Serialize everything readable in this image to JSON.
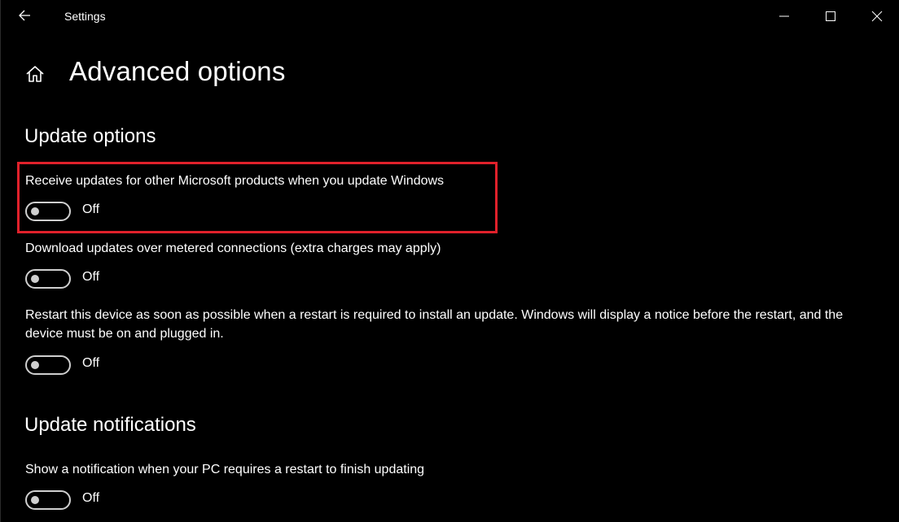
{
  "window": {
    "title": "Settings",
    "controls": [
      "minimize",
      "maximize",
      "close"
    ]
  },
  "page": {
    "title": "Advanced options"
  },
  "sections": [
    {
      "heading": "Update options",
      "settings": [
        {
          "label": "Receive updates for other Microsoft products when you update Windows",
          "state": "Off",
          "highlighted": true
        },
        {
          "label": "Download updates over metered connections (extra charges may apply)",
          "state": "Off"
        },
        {
          "label": "Restart this device as soon as possible when a restart is required to install an update. Windows will display a notice before the restart, and the device must be on and plugged in.",
          "state": "Off"
        }
      ]
    },
    {
      "heading": "Update notifications",
      "settings": [
        {
          "label": "Show a notification when your PC requires a restart to finish updating",
          "state": "Off"
        }
      ]
    }
  ],
  "colors": {
    "background": "#000000",
    "highlight_border": "#e0212b",
    "toggle_off": "#cfcfcf"
  }
}
